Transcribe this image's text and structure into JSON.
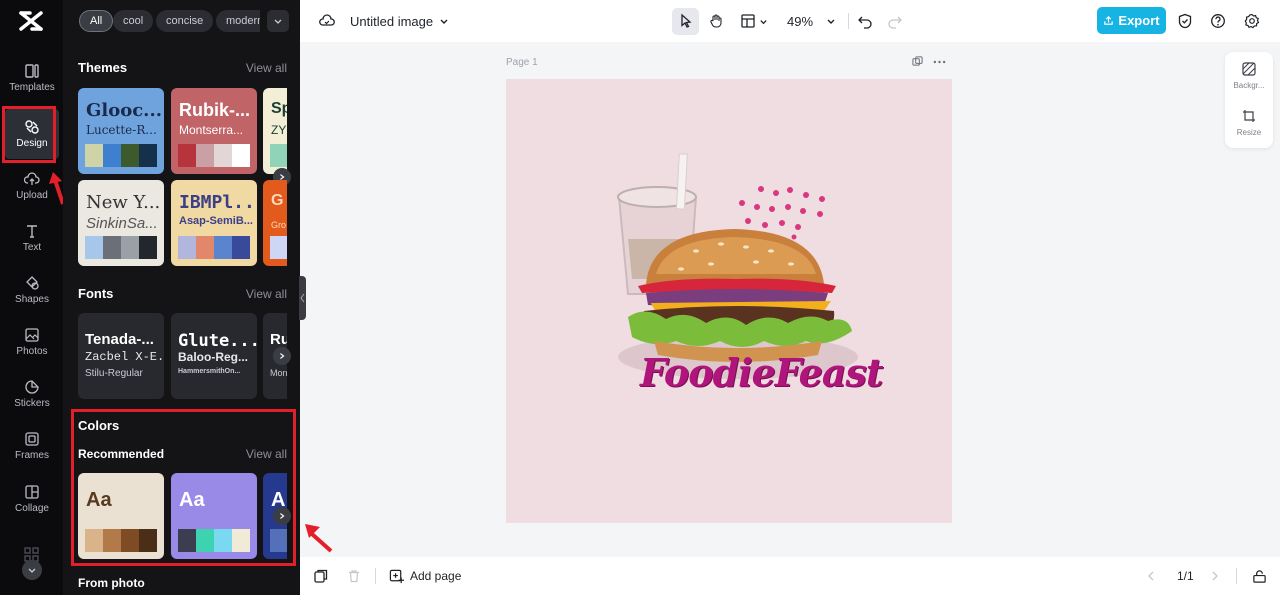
{
  "rail": {
    "items": [
      {
        "label": "Templates",
        "icon": "templates-icon"
      },
      {
        "label": "Design",
        "icon": "design-icon",
        "active": true
      },
      {
        "label": "Upload",
        "icon": "upload-icon"
      },
      {
        "label": "Text",
        "icon": "text-icon"
      },
      {
        "label": "Shapes",
        "icon": "shapes-icon"
      },
      {
        "label": "Photos",
        "icon": "photos-icon"
      },
      {
        "label": "Stickers",
        "icon": "stickers-icon"
      },
      {
        "label": "Frames",
        "icon": "frames-icon"
      },
      {
        "label": "Collage",
        "icon": "collage-icon"
      }
    ]
  },
  "panel": {
    "filters": [
      "All",
      "cool",
      "concise",
      "modern"
    ],
    "themes": {
      "title": "Themes",
      "view_all": "View all",
      "cards": [
        {
          "heading": "Glooc...",
          "sub": "Lucette-R...",
          "bg": "#6fa3dd",
          "fg": "#1a2a4a",
          "swatches": [
            "#cfd3a8",
            "#3f7fcf",
            "#3d5a2c",
            "#14304a"
          ]
        },
        {
          "heading": "Rubik-...",
          "sub": "Montserra...",
          "bg": "#c06467",
          "fg": "#ffffff",
          "swatches": [
            "#b8343d",
            "#c9a1a4",
            "#e3d6d6",
            "#ffffff"
          ]
        },
        {
          "heading": "Sp",
          "sub": "ZY",
          "bg": "#f2efd6",
          "fg": "#1b3d33",
          "swatches": [
            "#8fd3b8"
          ]
        },
        {
          "heading": "New Y...",
          "sub": "SinkinSa...",
          "bg": "#ebe7e1",
          "fg": "#333333",
          "swatches": [
            "#a7c7ea",
            "#6b7078",
            "#9aa0a8",
            "#22262d"
          ]
        },
        {
          "heading": "IBMPl...",
          "sub": "Asap-SemiB...",
          "bg": "#f1d9a3",
          "fg": "#3b3f88",
          "swatches": [
            "#b2b6dd",
            "#e3876c",
            "#5b84cf",
            "#3a4a9b"
          ]
        },
        {
          "heading": "G",
          "sub": "Gro",
          "bg": "#e25a1c",
          "fg": "#ffd9b8",
          "swatches": [
            "#cdd6f5"
          ]
        }
      ]
    },
    "fonts": {
      "title": "Fonts",
      "view_all": "View all",
      "cards": [
        {
          "line1": "Tenada-...",
          "line2": "Zacbel X-E...",
          "line3": "Stilu-Regular"
        },
        {
          "line1": "Glute...",
          "line2": "Baloo-Reg...",
          "line3": "HammersmithOn..."
        },
        {
          "line1": "Ru",
          "line2": "",
          "line3": "Mon"
        }
      ]
    },
    "colors": {
      "title": "Colors",
      "recommended": "Recommended",
      "view_all": "View all",
      "cards": [
        {
          "sample": "Aa",
          "bg": "#ebe1d3",
          "fg": "#5a3a1f",
          "swatches": [
            "#d9b48a",
            "#b27a48",
            "#7e4b25",
            "#4a2e17"
          ]
        },
        {
          "sample": "Aa",
          "bg": "#9a8ae8",
          "fg": "#ffffff",
          "swatches": [
            "#3d3d52",
            "#3ed3b0",
            "#7ad8f0",
            "#f1ead6"
          ]
        },
        {
          "sample": "A",
          "bg": "#253a8f",
          "fg": "#ffffff",
          "swatches": [
            "#5470b8"
          ]
        }
      ]
    },
    "from_photo": "From photo"
  },
  "topbar": {
    "title": "Untitled image",
    "zoom": "49%",
    "export": "Export"
  },
  "canvas": {
    "page_label": "Page 1",
    "brand_text": "FoodieFeast",
    "artboard_color": "#f0dde2"
  },
  "side_tools": {
    "background": "Backgr...",
    "resize": "Resize"
  },
  "bottombar": {
    "add_page": "Add page",
    "page_count": "1/1"
  }
}
